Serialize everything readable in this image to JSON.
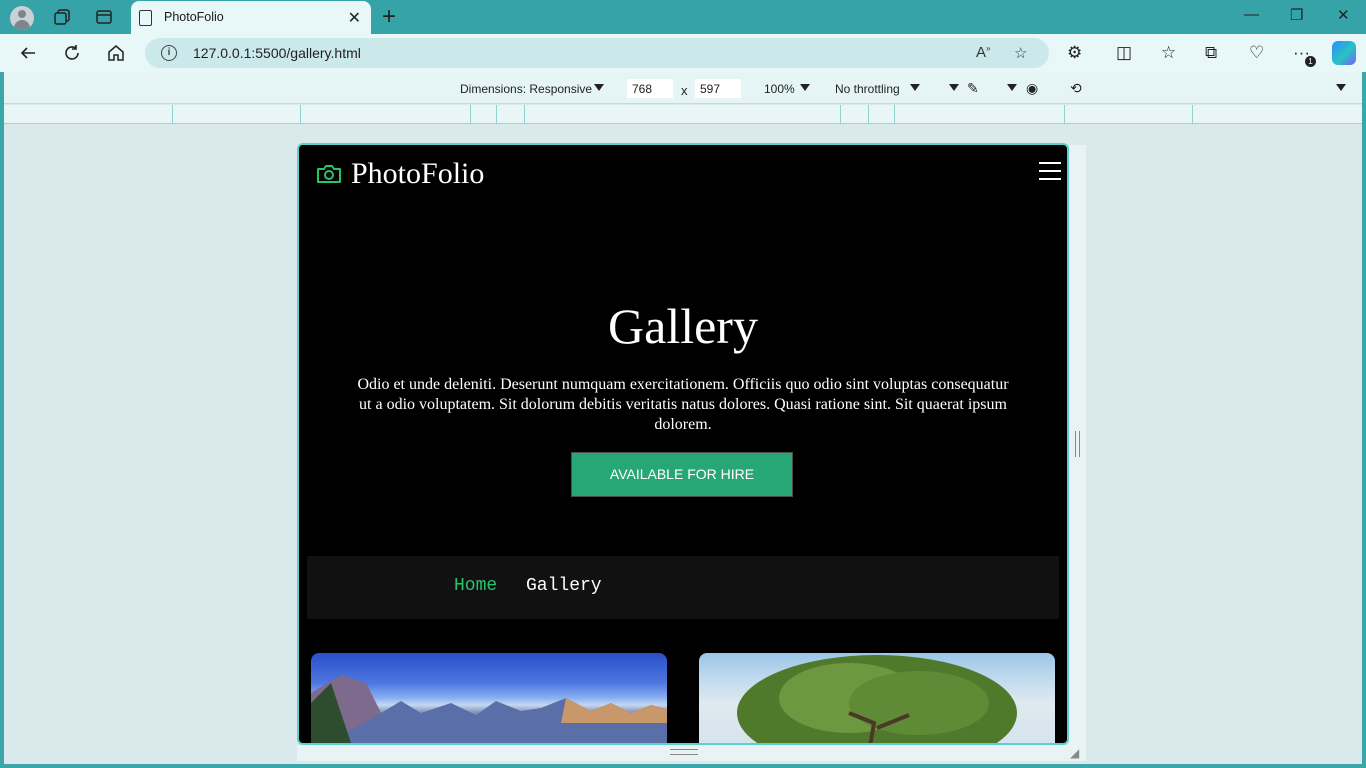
{
  "browser": {
    "tab_title": "PhotoFolio",
    "url": "127.0.0.1:5500/gallery.html",
    "extensions_badge": "1"
  },
  "devtools": {
    "dimensions_label": "Dimensions: Responsive",
    "width": "768",
    "height": "597",
    "separator": "x",
    "zoom": "100%",
    "throttling": "No throttling"
  },
  "page": {
    "brand": "PhotoFolio",
    "hero_title": "Gallery",
    "hero_text": "Odio et unde deleniti. Deserunt numquam exercitationem. Officiis quo odio sint voluptas consequatur ut a odio voluptatem. Sit dolorum debitis veritatis natus dolores. Quasi ratione sint. Sit quaerat ipsum dolorem.",
    "cta_label": "AVAILABLE FOR HIRE",
    "breadcrumb": {
      "home": "Home",
      "current": "Gallery"
    }
  },
  "colors": {
    "accent": "#27a776",
    "breadcrumb_link": "#27c46e",
    "page_bg": "#000000",
    "browser_chrome": "#35a3a7"
  }
}
